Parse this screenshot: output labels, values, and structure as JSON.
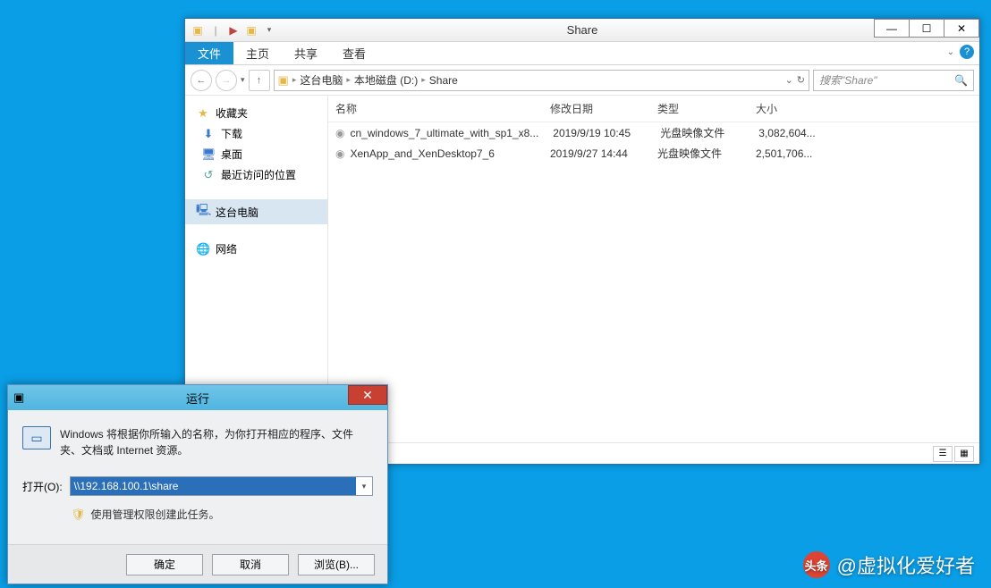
{
  "explorer": {
    "title": "Share",
    "ribbon": {
      "tabs": [
        "文件",
        "主页",
        "共享",
        "查看"
      ]
    },
    "breadcrumb": [
      "这台电脑",
      "本地磁盘 (D:)",
      "Share"
    ],
    "search_placeholder": "搜索\"Share\"",
    "nav": {
      "favorites_label": "收藏夹",
      "downloads": "下载",
      "desktop": "桌面",
      "recent": "最近访问的位置",
      "this_pc": "这台电脑",
      "network": "网络"
    },
    "columns": {
      "name": "名称",
      "date": "修改日期",
      "type": "类型",
      "size": "大小"
    },
    "rows": [
      {
        "name": "cn_windows_7_ultimate_with_sp1_x8...",
        "date": "2019/9/19 10:45",
        "type": "光盘映像文件",
        "size": "3,082,604..."
      },
      {
        "name": "XenApp_and_XenDesktop7_6",
        "date": "2019/9/27 14:44",
        "type": "光盘映像文件",
        "size": "2,501,706..."
      }
    ]
  },
  "run": {
    "title": "运行",
    "desc": "Windows 将根据你所输入的名称，为你打开相应的程序、文件夹、文档或 Internet 资源。",
    "open_label": "打开(O):",
    "value": "\\\\192.168.100.1\\share",
    "note": "使用管理权限创建此任务。",
    "buttons": {
      "ok": "确定",
      "cancel": "取消",
      "browse": "浏览(B)..."
    }
  },
  "watermark": {
    "logo": "头条",
    "text": "@虚拟化爱好者"
  }
}
